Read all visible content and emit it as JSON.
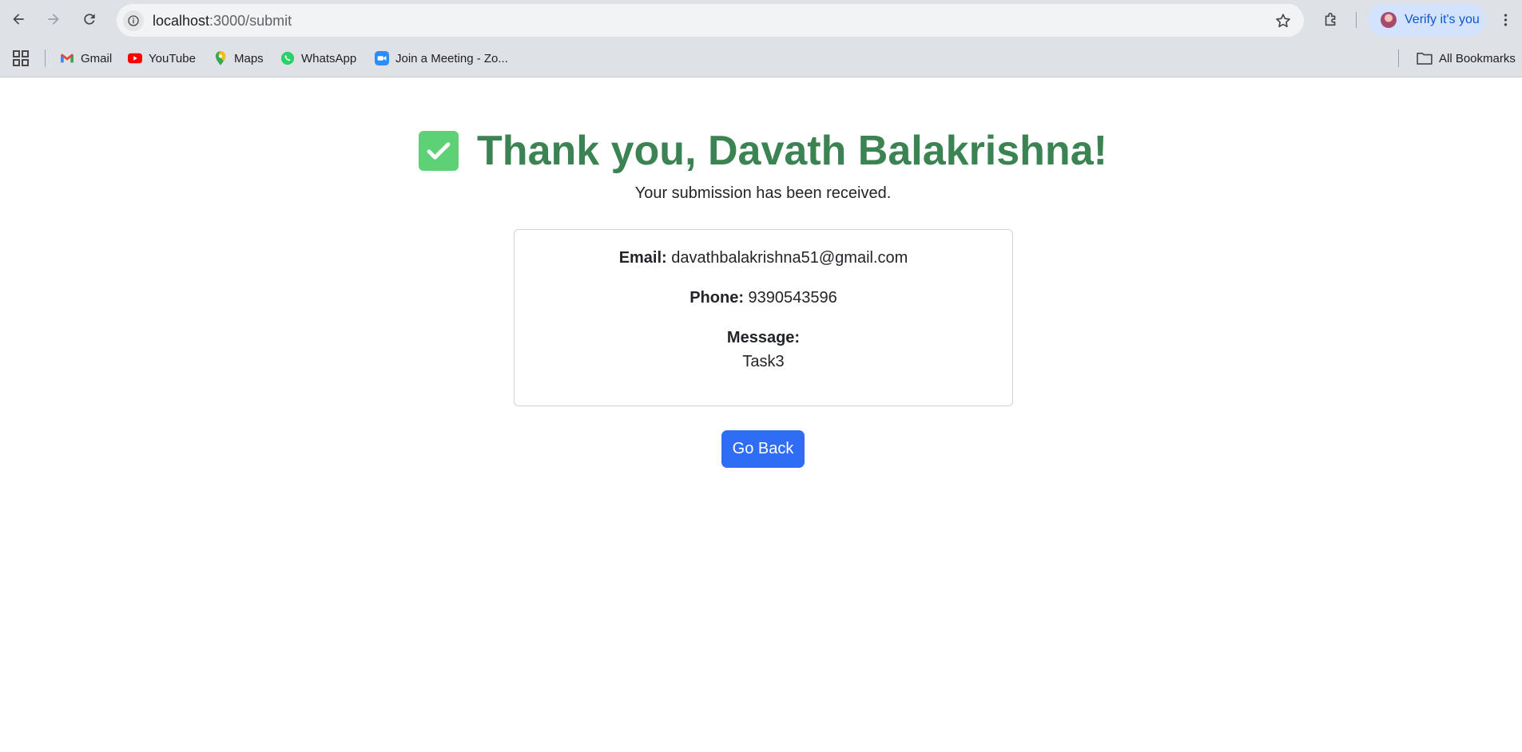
{
  "browser": {
    "url_host": "localhost",
    "url_path": ":3000/submit",
    "profile_label": "Verify it's you",
    "icons": {
      "back": "back-arrow-icon",
      "forward": "forward-arrow-icon",
      "reload": "reload-icon",
      "site_info": "site-info-icon",
      "bookmark": "star-icon",
      "extensions": "extensions-icon",
      "menu": "kebab-menu-icon"
    }
  },
  "bookmarks": {
    "items": [
      {
        "label": "Gmail",
        "icon": "gmail-icon"
      },
      {
        "label": "YouTube",
        "icon": "youtube-icon"
      },
      {
        "label": "Maps",
        "icon": "maps-icon"
      },
      {
        "label": "WhatsApp",
        "icon": "whatsapp-icon"
      },
      {
        "label": "Join a Meeting - Zo...",
        "icon": "zoom-icon"
      }
    ],
    "all_bookmarks_label": "All Bookmarks"
  },
  "page": {
    "title": "Thank you, Davath Balakrishna!",
    "subtitle": "Your submission has been received.",
    "email_label": "Email:",
    "email_value": "davathbalakrishna51@gmail.com",
    "phone_label": "Phone:",
    "phone_value": "9390543596",
    "message_label": "Message:",
    "message_value": "Task3",
    "go_back_label": "Go Back"
  },
  "colors": {
    "title_green": "#3b8353",
    "check_green": "#5dd175",
    "button_blue": "#2f6ef4",
    "chrome_bar": "#dee1e6"
  }
}
